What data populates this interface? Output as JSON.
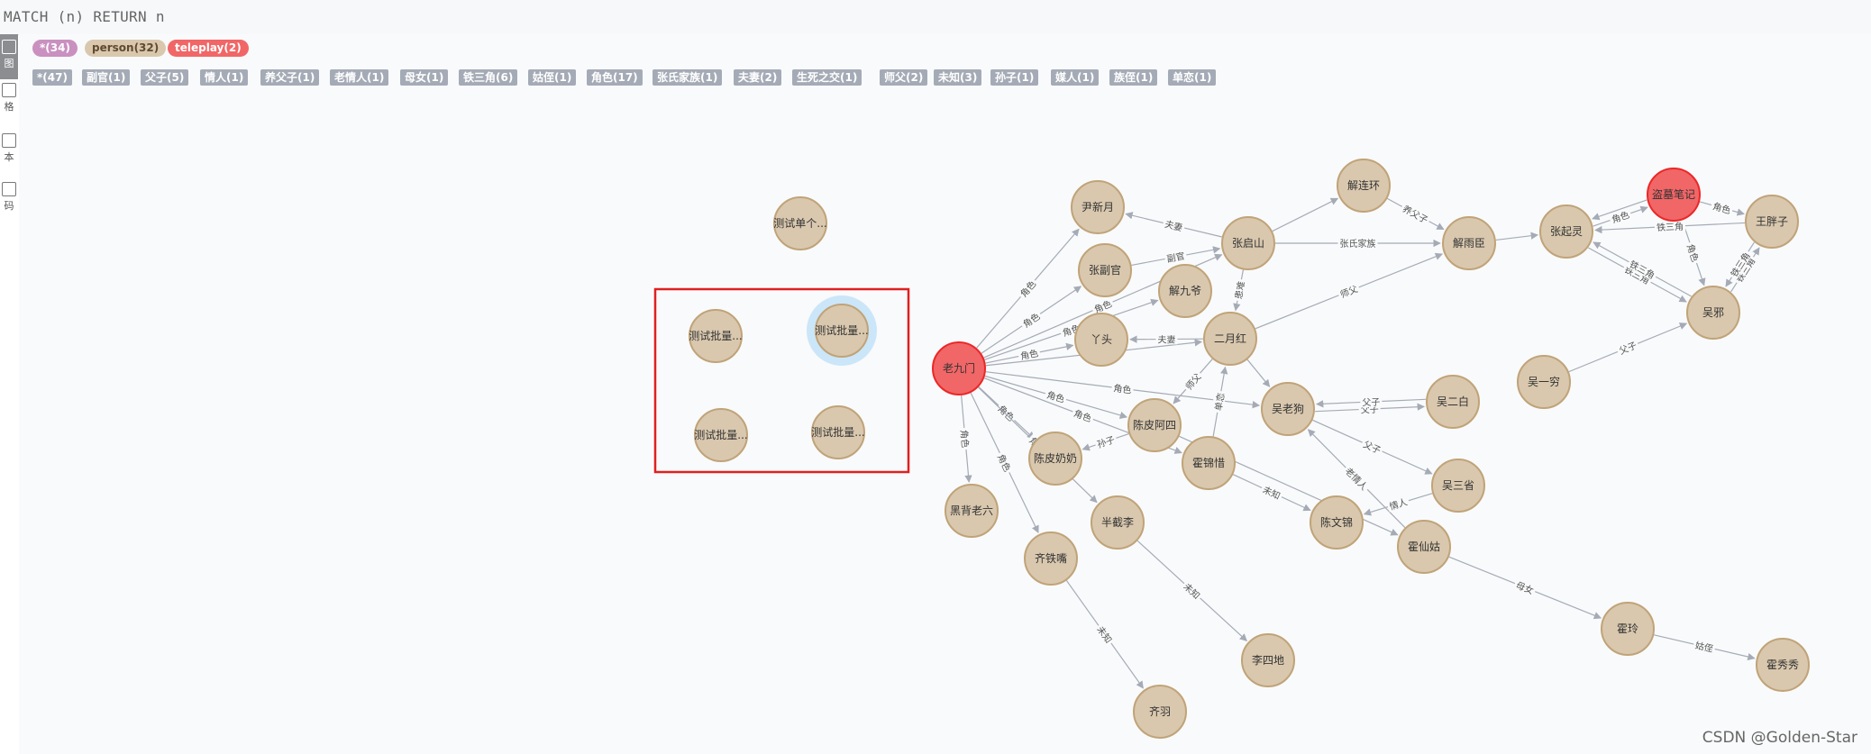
{
  "query": {
    "text": "MATCH (n) RETURN n"
  },
  "sidebar": [
    {
      "label": "图",
      "icon": "graph-icon",
      "active": true
    },
    {
      "label": "格",
      "icon": "table-icon",
      "active": false
    },
    {
      "label": "本",
      "icon": "text-icon",
      "active": false
    },
    {
      "label": "码",
      "icon": "code-icon",
      "active": false
    }
  ],
  "labels": [
    {
      "text": "*(34)",
      "bg": "#c990c0",
      "fg": "#ffffff"
    },
    {
      "text": "person(32)",
      "bg": "#d9c8ae",
      "fg": "#604a30"
    },
    {
      "text": "teleplay(2)",
      "bg": "#f16667",
      "fg": "#ffffff"
    }
  ],
  "relationship_types": [
    "*(47)",
    "副官(1)",
    "父子(5)",
    "情人(1)",
    "养父子(1)",
    "老情人(1)",
    "母女(1)",
    "铁三角(6)",
    "姑侄(1)",
    "角色(17)",
    "张氏家族(1)",
    "夫妻(2)",
    "生死之交(1)",
    "师父(2)",
    "未知(3)",
    "孙子(1)",
    "媒人(1)",
    "族侄(1)",
    "单恋(1)"
  ],
  "colors": {
    "person_fill": "#d9c8ae",
    "person_stroke": "#c0a378",
    "teleplay_fill": "#f16667",
    "teleplay_stroke": "#eb2728",
    "edge": "#a5abb6",
    "selection_box": "#e02020",
    "selected_halo": "#cbe6f8"
  },
  "nodes": [
    {
      "id": "test1",
      "label": "测试单个...",
      "kind": "person"
    },
    {
      "id": "b1",
      "label": "测试批量...",
      "kind": "person"
    },
    {
      "id": "b2",
      "label": "测试批量...",
      "kind": "person",
      "selected": true
    },
    {
      "id": "b3",
      "label": "测试批量...",
      "kind": "person"
    },
    {
      "id": "b4",
      "label": "测试批量...",
      "kind": "person"
    },
    {
      "id": "lao9",
      "label": "老九门",
      "kind": "teleplay"
    },
    {
      "id": "daomu",
      "label": "盗墓笔记",
      "kind": "teleplay"
    },
    {
      "id": "yinxy",
      "label": "尹新月",
      "kind": "person"
    },
    {
      "id": "zhangfg",
      "label": "张副官",
      "kind": "person"
    },
    {
      "id": "xiej",
      "label": "解九爷",
      "kind": "person"
    },
    {
      "id": "zhangqs",
      "label": "张启山",
      "kind": "person"
    },
    {
      "id": "xielh",
      "label": "解连环",
      "kind": "person"
    },
    {
      "id": "xieyc",
      "label": "解雨臣",
      "kind": "person"
    },
    {
      "id": "zhangql",
      "label": "张起灵",
      "kind": "person"
    },
    {
      "id": "wangpz",
      "label": "王胖子",
      "kind": "person"
    },
    {
      "id": "wuxie",
      "label": "吴邪",
      "kind": "person"
    },
    {
      "id": "yatou",
      "label": "丫头",
      "kind": "person"
    },
    {
      "id": "eryh",
      "label": "二月红",
      "kind": "person"
    },
    {
      "id": "wulg",
      "label": "吴老狗",
      "kind": "person"
    },
    {
      "id": "wueb",
      "label": "吴二白",
      "kind": "person"
    },
    {
      "id": "wuyq",
      "label": "吴一穷",
      "kind": "person"
    },
    {
      "id": "wusx",
      "label": "吴三省",
      "kind": "person"
    },
    {
      "id": "chenps",
      "label": "陈皮阿四",
      "kind": "person"
    },
    {
      "id": "chenpnn",
      "label": "陈皮奶奶",
      "kind": "person"
    },
    {
      "id": "huojx",
      "label": "霍锦惜",
      "kind": "person"
    },
    {
      "id": "chenwj",
      "label": "陈文锦",
      "kind": "person"
    },
    {
      "id": "huoxg",
      "label": "霍仙姑",
      "kind": "person"
    },
    {
      "id": "heib",
      "label": "黑背老六",
      "kind": "person"
    },
    {
      "id": "banjl",
      "label": "半截李",
      "kind": "person"
    },
    {
      "id": "qitz",
      "label": "齐铁嘴",
      "kind": "person"
    },
    {
      "id": "lisd",
      "label": "李四地",
      "kind": "person"
    },
    {
      "id": "qiyu",
      "label": "齐羽",
      "kind": "person"
    },
    {
      "id": "huoling",
      "label": "霍玲",
      "kind": "person"
    },
    {
      "id": "huoxx",
      "label": "霍秀秀",
      "kind": "person"
    }
  ],
  "edges": [
    {
      "from": "lao9",
      "to": "yinxy",
      "label": "角色"
    },
    {
      "from": "lao9",
      "to": "zhangfg",
      "label": "角色"
    },
    {
      "from": "lao9",
      "to": "xiej",
      "label": "角色"
    },
    {
      "from": "lao9",
      "to": "yatou",
      "label": "角色"
    },
    {
      "from": "lao9",
      "to": "zhangqs",
      "label": "角色"
    },
    {
      "from": "lao9",
      "to": "eryh",
      "label": "角色"
    },
    {
      "from": "lao9",
      "to": "wulg",
      "label": "角色"
    },
    {
      "from": "lao9",
      "to": "chenps",
      "label": "角色"
    },
    {
      "from": "lao9",
      "to": "huojx",
      "label": "角色"
    },
    {
      "from": "lao9",
      "to": "chenpnn",
      "label": "角色"
    },
    {
      "from": "lao9",
      "to": "heib",
      "label": "角色"
    },
    {
      "from": "lao9",
      "to": "qitz",
      "label": "角色"
    },
    {
      "from": "lao9",
      "to": "banjl",
      "label": "角色"
    },
    {
      "from": "zhangqs",
      "to": "yinxy",
      "label": "夫妻"
    },
    {
      "from": "zhangfg",
      "to": "zhangqs",
      "label": "副官"
    },
    {
      "from": "zhangqs",
      "to": "xielh",
      "label": ""
    },
    {
      "from": "zhangqs",
      "to": "xieyc",
      "label": "张氏家族"
    },
    {
      "from": "zhangqs",
      "to": "eryh",
      "label": "患难"
    },
    {
      "from": "xielh",
      "to": "xieyc",
      "label": "养父子"
    },
    {
      "from": "eryh",
      "to": "yatou",
      "label": "夫妻"
    },
    {
      "from": "eryh",
      "to": "xieyc",
      "label": "师父"
    },
    {
      "from": "eryh",
      "to": "chenps",
      "label": "师父"
    },
    {
      "from": "eryh",
      "to": "wulg",
      "label": ""
    },
    {
      "from": "huojx",
      "to": "eryh",
      "label": "单恋"
    },
    {
      "from": "chenps",
      "to": "chenpnn",
      "label": "孙子"
    },
    {
      "from": "huojx",
      "to": "chenwj",
      "label": "未知"
    },
    {
      "from": "chenps",
      "to": "huoxg",
      "label": ""
    },
    {
      "from": "wulg",
      "to": "wueb",
      "label": "父子"
    },
    {
      "from": "wulg",
      "to": "wusx",
      "label": "父子"
    },
    {
      "from": "wueb",
      "to": "wulg",
      "label": "父子"
    },
    {
      "from": "wuyq",
      "to": "wuxie",
      "label": "父子"
    },
    {
      "from": "huoxg",
      "to": "wulg",
      "label": "老情人"
    },
    {
      "from": "wusx",
      "to": "chenwj",
      "label": "情人"
    },
    {
      "from": "huoxg",
      "to": "huoling",
      "label": "母女"
    },
    {
      "from": "huoling",
      "to": "huoxx",
      "label": "姑侄"
    },
    {
      "from": "banjl",
      "to": "lisd",
      "label": "未知"
    },
    {
      "from": "qitz",
      "to": "qiyu",
      "label": "未知"
    },
    {
      "from": "xieyc",
      "to": "zhangql",
      "label": ""
    },
    {
      "from": "zhangql",
      "to": "daomu",
      "label": "角色"
    },
    {
      "from": "daomu",
      "to": "zhangql",
      "label": ""
    },
    {
      "from": "daomu",
      "to": "wangpz",
      "label": "角色"
    },
    {
      "from": "daomu",
      "to": "wuxie",
      "label": "角色"
    },
    {
      "from": "zhangql",
      "to": "wuxie",
      "label": "铁三角"
    },
    {
      "from": "wuxie",
      "to": "zhangql",
      "label": "铁三角"
    },
    {
      "from": "wuxie",
      "to": "wangpz",
      "label": "铁三角"
    },
    {
      "from": "wangpz",
      "to": "wuxie",
      "label": "铁三角"
    },
    {
      "from": "wangpz",
      "to": "zhangql",
      "label": "铁三角"
    }
  ],
  "watermark": "CSDN @Golden-Star"
}
